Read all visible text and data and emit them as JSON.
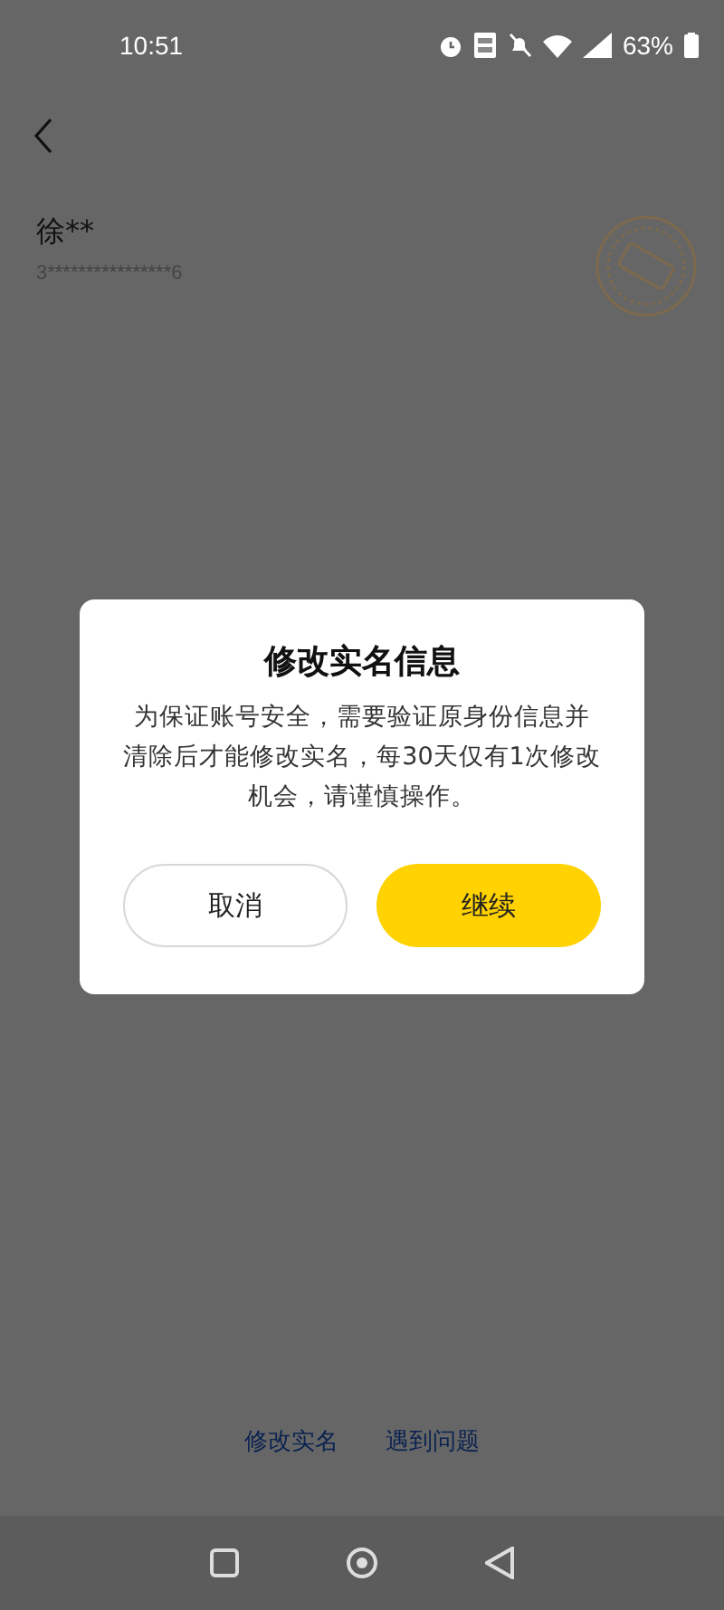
{
  "status_bar": {
    "time": "10:51",
    "battery": "63%"
  },
  "profile": {
    "name": "徐**",
    "id_number": "3****************6"
  },
  "dialog": {
    "title": "修改实名信息",
    "message": "为保证账号安全，需要验证原身份信息并清除后才能修改实名，每30天仅有1次修改机会，请谨慎操作。",
    "buttons": [
      {
        "label": "取消",
        "kind": "secondary"
      },
      {
        "label": "继续",
        "kind": "primary"
      }
    ]
  },
  "footer_links": [
    "修改实名",
    "遇到问题"
  ]
}
